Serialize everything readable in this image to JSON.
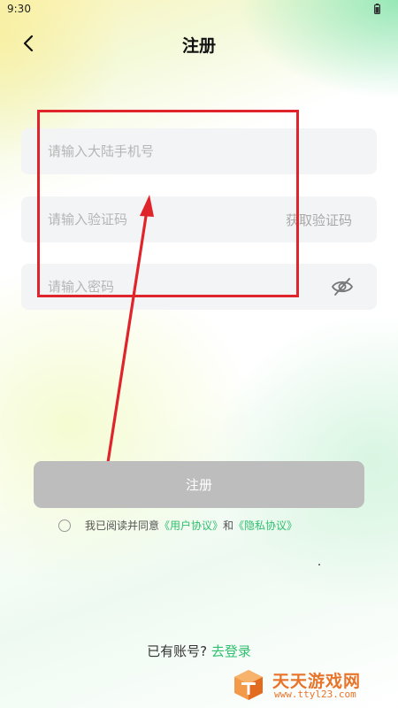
{
  "status_bar": {
    "time": "9:30",
    "battery_icon": "battery-icon"
  },
  "header": {
    "back_icon": "chevron-left-icon",
    "title": "注册"
  },
  "form": {
    "phone_placeholder": "请输入大陆手机号",
    "code_placeholder": "请输入验证码",
    "get_code_label": "获取验证码",
    "password_placeholder": "请输入密码",
    "password_visibility_icon": "eye-off-icon"
  },
  "register_button": "注册",
  "agreement": {
    "prefix": "我已阅读并同意",
    "user_agreement": "《用户协议》",
    "and": "和",
    "privacy_agreement": "《隐私协议》"
  },
  "login": {
    "prompt": "已有账号?",
    "link": "去登录"
  },
  "watermark": {
    "title": "天天游戏网",
    "url": "www.ttyl23.com"
  },
  "colors": {
    "accent_green": "#2fbf6e",
    "annotation_red": "#e0242b",
    "button_disabled": "#bdbdbd",
    "watermark_orange": "#e8742a"
  }
}
